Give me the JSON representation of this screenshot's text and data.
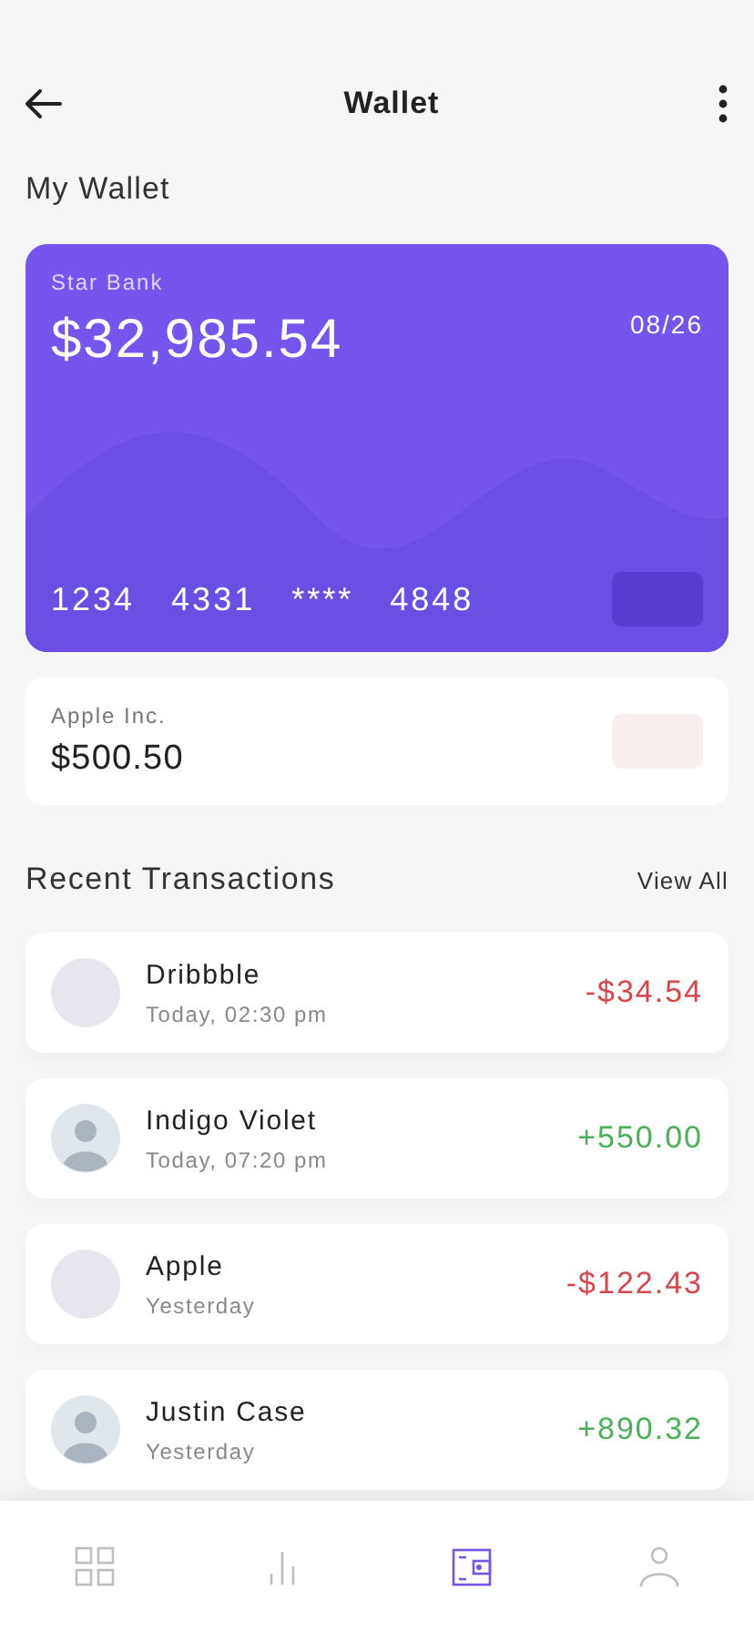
{
  "header": {
    "title": "Wallet"
  },
  "section_title": "My Wallet",
  "bank_card": {
    "bank": "Star Bank",
    "balance": "$32,985.54",
    "expiry": "08/26",
    "number_groups": [
      "1234",
      "4331",
      "****",
      "4848"
    ]
  },
  "secondary_card": {
    "name": "Apple Inc.",
    "amount": "$500.50"
  },
  "transactions_header": {
    "title": "Recent Transactions",
    "link": "View All"
  },
  "transactions": [
    {
      "name": "Dribbble",
      "time": "Today, 02:30 pm",
      "amount": "-$34.54",
      "color": "#d5474b",
      "kind": "placeholder"
    },
    {
      "name": "Indigo Violet",
      "time": "Today, 07:20 pm",
      "amount": "+550.00",
      "color": "#4caf5a",
      "kind": "photo"
    },
    {
      "name": "Apple",
      "time": "Yesterday",
      "amount": "-$122.43",
      "color": "#d5474b",
      "kind": "placeholder"
    },
    {
      "name": "Justin Case",
      "time": "Yesterday",
      "amount": "+890.32",
      "color": "#4caf5a",
      "kind": "photo"
    }
  ],
  "nav": [
    {
      "kind": "grid",
      "selected": false
    },
    {
      "kind": "chart",
      "selected": false
    },
    {
      "kind": "wallet",
      "selected": true
    },
    {
      "kind": "profile",
      "selected": false
    }
  ]
}
